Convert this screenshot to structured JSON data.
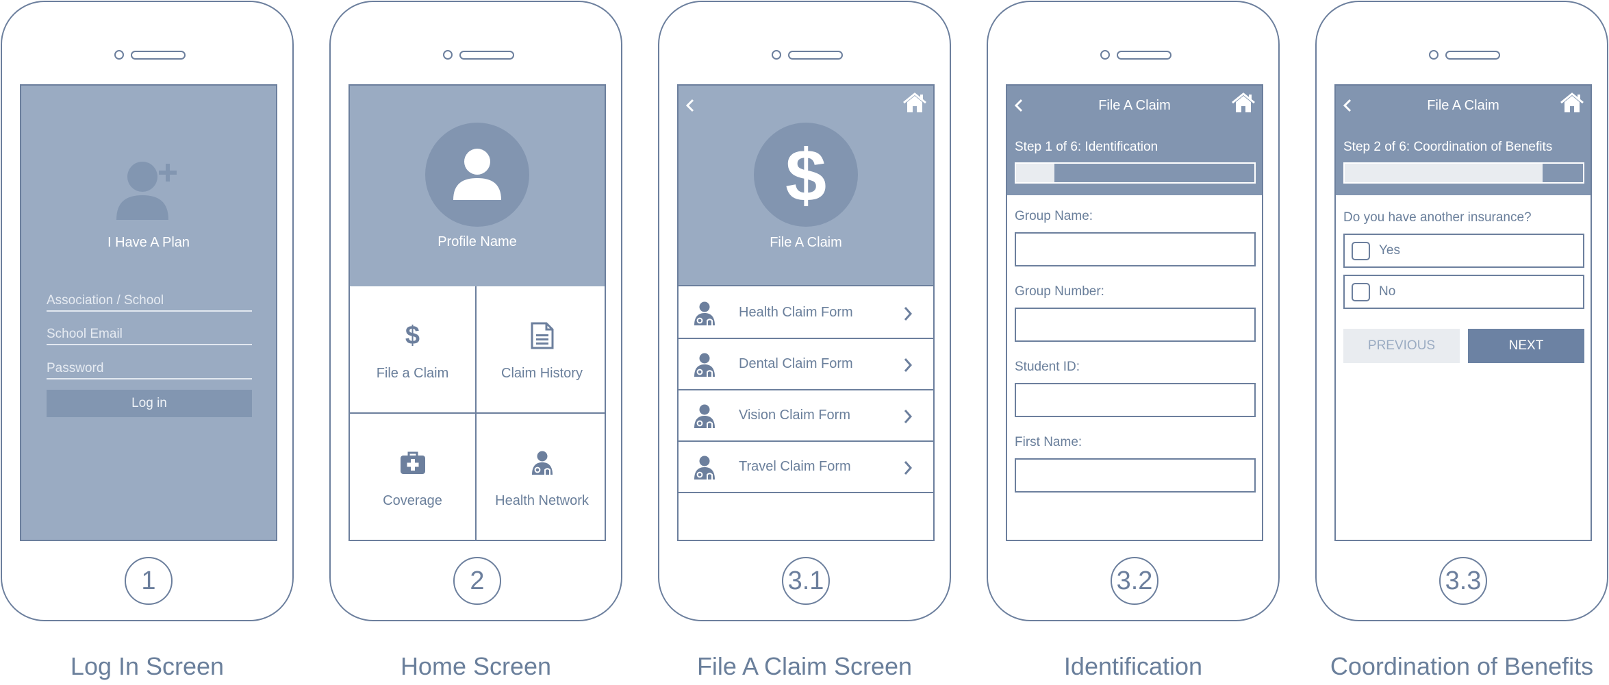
{
  "screens": [
    {
      "number": "1",
      "caption": "Log In Screen"
    },
    {
      "number": "2",
      "caption": "Home Screen"
    },
    {
      "number": "3.1",
      "caption": "File A Claim Screen"
    },
    {
      "number": "3.2",
      "caption": "Identification"
    },
    {
      "number": "3.3",
      "caption": "Coordination of Benefits"
    }
  ],
  "login": {
    "plan_label": "I Have A Plan",
    "field1": "Association / School",
    "field2": "School Email",
    "field3": "Password",
    "button": "Log in"
  },
  "home": {
    "profile_name": "Profile Name",
    "tiles": [
      {
        "label": "File a Claim",
        "icon": "dollar-icon"
      },
      {
        "label": "Claim History",
        "icon": "document-icon"
      },
      {
        "label": "Coverage",
        "icon": "medical-kit-icon"
      },
      {
        "label": "Health Network",
        "icon": "doctor-icon"
      }
    ]
  },
  "claim": {
    "title": "File A Claim",
    "forms": [
      "Health Claim Form",
      "Dental Claim Form",
      "Vision Claim Form",
      "Travel Claim Form"
    ]
  },
  "ident": {
    "header": "File A Claim",
    "step": "Step 1 of 6: Identification",
    "progress": 0.16,
    "labels": [
      "Group Name:",
      "Group Number:",
      "Student ID:",
      "First Name:"
    ]
  },
  "coord": {
    "header": "File A Claim",
    "step": "Step 2 of 6: Coordination of Benefits",
    "progress": 0.83,
    "question": "Do you have another insurance?",
    "options": [
      "Yes",
      "No"
    ],
    "previous": "PREVIOUS",
    "next": "NEXT"
  },
  "colors": {
    "outline": "#6c7f9d",
    "panel": "#9aabc2",
    "dark_panel": "#8295b0",
    "accent": "#6c82a3"
  }
}
